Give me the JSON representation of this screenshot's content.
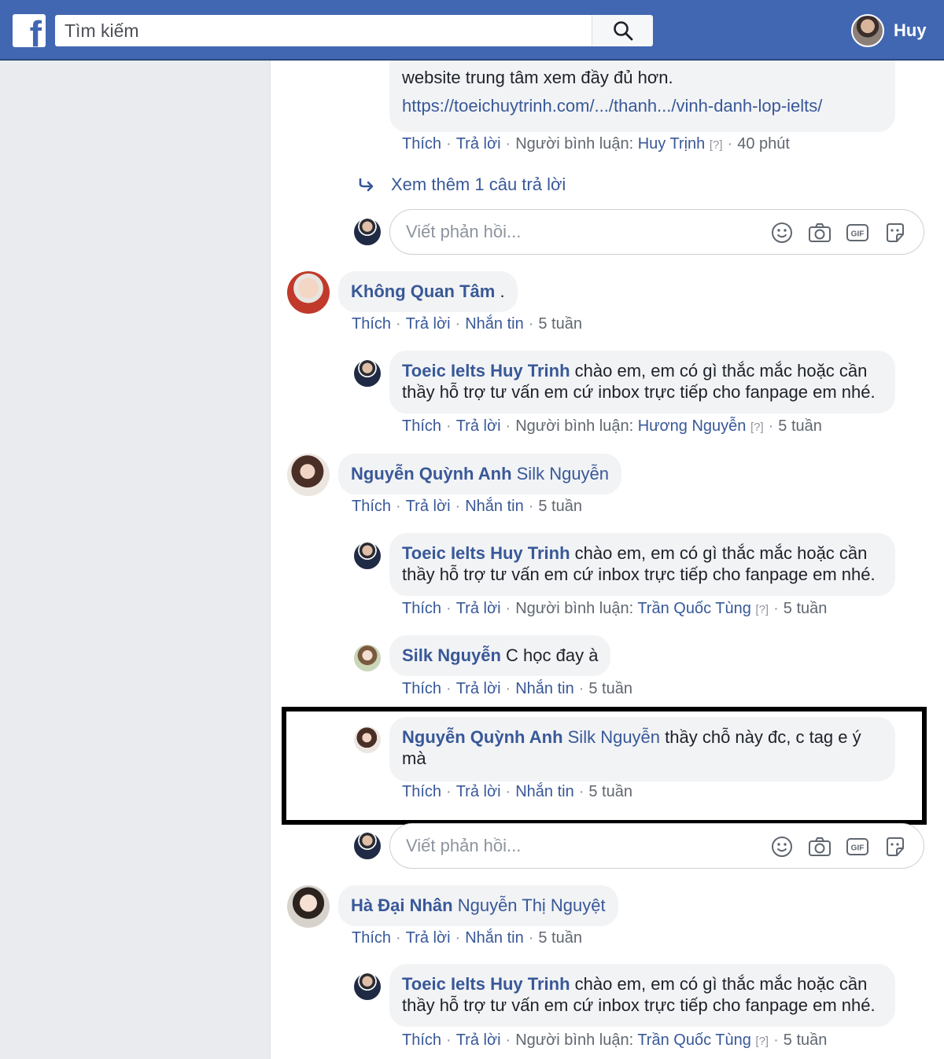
{
  "topbar": {
    "logo_letter": "f",
    "search_placeholder": "Tìm kiếm",
    "profile_name": "Huy"
  },
  "comments": {
    "c0": {
      "text_line1": "website trung tâm xem đầy đủ hơn.",
      "link": "https://toeichuytrinh.com/.../thanh.../vinh-danh-lop-ielts/",
      "like": "Thích",
      "reply": "Trả lời",
      "commenter_label": "Người bình luận:",
      "commenter": "Huy Trịnh",
      "q": "[?]",
      "time": "40 phút"
    },
    "see_more": "Xem thêm 1 câu trả lời",
    "reply_placeholder": "Viết phản hồi...",
    "c1": {
      "author": "Không Quan Tâm",
      "suffix": " .",
      "like": "Thích",
      "reply": "Trả lời",
      "message": "Nhắn tin",
      "time": "5 tuần"
    },
    "c1r": {
      "author": "Toeic Ielts Huy Trinh",
      "text": " chào em, em có gì thắc mắc hoặc cần thầy hỗ trợ tư vấn em cứ inbox trực tiếp cho fanpage em nhé.",
      "like": "Thích",
      "reply": "Trả lời",
      "commenter_label": "Người bình luận:",
      "commenter": "Hương Nguyễn",
      "q": "[?]",
      "time": "5 tuần"
    },
    "c2": {
      "author": "Nguyễn Quỳnh Anh",
      "tag": " Silk Nguyễn",
      "like": "Thích",
      "reply": "Trả lời",
      "message": "Nhắn tin",
      "time": "5 tuần"
    },
    "c2r1": {
      "author": "Toeic Ielts Huy Trinh",
      "text": " chào em, em có gì thắc mắc hoặc cần thầy hỗ trợ tư vấn em cứ inbox trực tiếp cho fanpage em nhé.",
      "like": "Thích",
      "reply": "Trả lời",
      "commenter_label": "Người bình luận:",
      "commenter": "Trần Quốc Tùng",
      "q": "[?]",
      "time": "5 tuần"
    },
    "c2r2": {
      "author": "Silk Nguyễn",
      "text": " C học đay à",
      "like": "Thích",
      "reply": "Trả lời",
      "message": "Nhắn tin",
      "time": "5 tuần"
    },
    "c2r3": {
      "author": "Nguyễn Quỳnh Anh",
      "tag": " Silk Nguyễn",
      "text": " thầy chỗ này đc, c tag e ý mà",
      "like": "Thích",
      "reply": "Trả lời",
      "message": "Nhắn tin",
      "time": "5 tuần"
    },
    "c3": {
      "author": "Hà Đại Nhân",
      "tag": " Nguyễn Thị Nguyệt",
      "like": "Thích",
      "reply": "Trả lời",
      "message": "Nhắn tin",
      "time": "5 tuần"
    },
    "c3r": {
      "author": "Toeic Ielts Huy Trinh",
      "text": " chào em, em có gì thắc mắc hoặc cần thầy hỗ trợ tư vấn em cứ inbox trực tiếp cho fanpage em nhé.",
      "like": "Thích",
      "reply": "Trả lời",
      "commenter_label": "Người bình luận:",
      "commenter": "Trần Quốc Tùng",
      "q": "[?]",
      "time": "5 tuần"
    }
  },
  "colors": {
    "topbar": "#4267b2",
    "link": "#385898",
    "bubble": "#f2f3f5",
    "highlight_border": "#000000"
  }
}
